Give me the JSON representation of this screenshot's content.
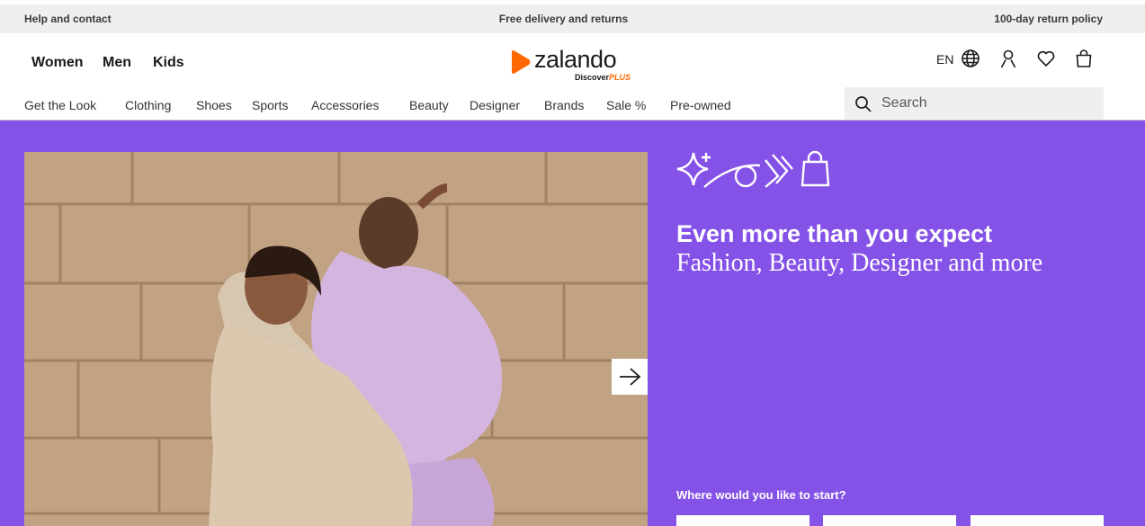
{
  "topbar": {
    "help": "Help and contact",
    "delivery": "Free delivery and returns",
    "returns": "100-day return policy"
  },
  "header": {
    "genders": [
      "Women",
      "Men",
      "Kids"
    ],
    "logo": {
      "word": "zalando",
      "discover": "Discover",
      "plus": "PLUS"
    },
    "language": "EN",
    "icons": [
      "globe-icon",
      "user-icon",
      "heart-icon",
      "bag-icon"
    ]
  },
  "categories": [
    "Get the Look",
    "Clothing",
    "Shoes",
    "Sports",
    "Accessories",
    "Beauty",
    "Designer",
    "Brands",
    "Sale %",
    "Pre-owned"
  ],
  "search": {
    "placeholder": "Search",
    "value": ""
  },
  "hero": {
    "headline": "Even more than you expect",
    "subline": "Fashion, Beauty, Designer and more",
    "prompt": "Where would you like to start?",
    "next_icon": "arrow-right-icon"
  },
  "colors": {
    "brand_orange": "#ff6900",
    "hero_purple": "#8552e8",
    "topbar_gray": "#efeff0"
  }
}
